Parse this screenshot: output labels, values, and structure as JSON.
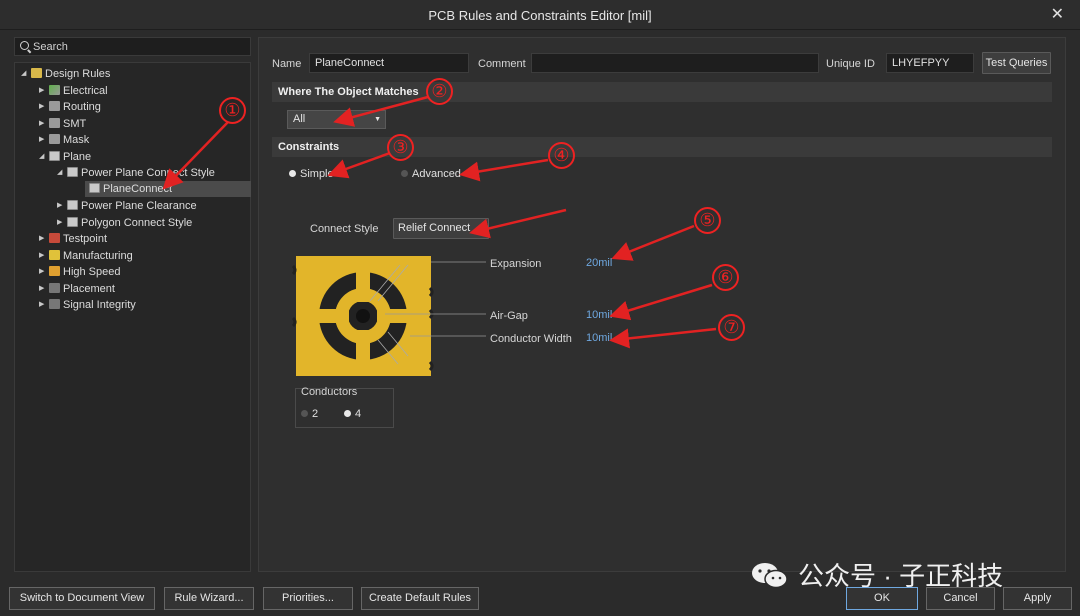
{
  "window": {
    "title": "PCB Rules and Constraints Editor [mil]",
    "close_glyph": "✕"
  },
  "search": {
    "placeholder": "Search"
  },
  "tree": {
    "root": "Design Rules",
    "electrical": "Electrical",
    "routing": "Routing",
    "smt": "SMT",
    "mask": "Mask",
    "plane": "Plane",
    "power_plane_connect_style": "Power Plane Connect Style",
    "planeconnect": "PlaneConnect",
    "power_plane_clearance": "Power Plane Clearance",
    "polygon_connect_style": "Polygon Connect Style",
    "testpoint": "Testpoint",
    "manufacturing": "Manufacturing",
    "high_speed": "High Speed",
    "placement": "Placement",
    "signal_integrity": "Signal Integrity"
  },
  "rule": {
    "name_label": "Name",
    "name_value": "PlaneConnect",
    "comment_label": "Comment",
    "comment_value": "",
    "uid_label": "Unique ID",
    "uid_value": "LHYEFPYY",
    "test_queries": "Test Queries"
  },
  "where": {
    "heading": "Where The Object Matches",
    "selected": "All"
  },
  "constraints": {
    "heading": "Constraints",
    "mode_simple": "Simple",
    "mode_advanced": "Advanced",
    "connect_style_label": "Connect Style",
    "connect_style_value": "Relief Connect",
    "expansion_label": "Expansion",
    "expansion_value": "20mil",
    "airgap_label": "Air-Gap",
    "airgap_value": "10mil",
    "conductor_width_label": "Conductor Width",
    "conductor_width_value": "10mil",
    "conductors_label": "Conductors",
    "conductors_2": "2",
    "conductors_4": "4"
  },
  "annotations": [
    "①",
    "②",
    "③",
    "④",
    "⑤",
    "⑥",
    "⑦"
  ],
  "footer": {
    "switch_view": "Switch to Document View",
    "rule_wizard": "Rule Wizard...",
    "priorities": "Priorities...",
    "create_default": "Create Default Rules",
    "ok": "OK",
    "cancel": "Cancel",
    "apply": "Apply"
  },
  "watermark": "公众号 · 子正科技",
  "colors": {
    "annotation_red": "#e22222",
    "thermal_yellow": "#e2b52a",
    "link_blue": "#6fa8e0"
  }
}
